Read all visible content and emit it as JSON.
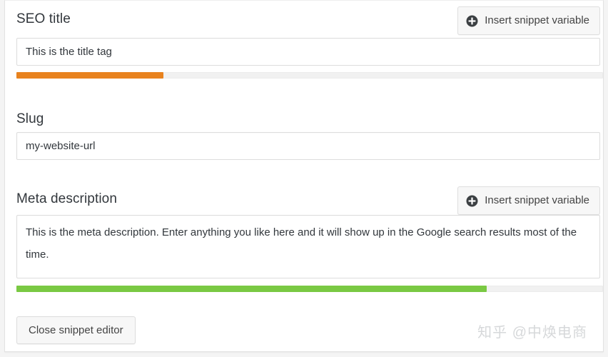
{
  "colors": {
    "orange_bar": "#e8821e",
    "green_bar": "#7ac943",
    "track": "#f1f1f1",
    "card_bg": "#ffffff",
    "page_bg": "#f4f4f4",
    "text": "#32373c",
    "button_bg": "#f7f7f7",
    "button_border": "#dcdcdc",
    "watermark": "#d6d8da"
  },
  "seo_title": {
    "label": "SEO title",
    "insert_button_label": "Insert snippet variable",
    "insert_button_icon": "plus-circle-icon",
    "value": "This is the title tag",
    "placeholder": "",
    "progress": {
      "percent": 25,
      "color": "#e8821e",
      "status": "ok"
    }
  },
  "slug": {
    "label": "Slug",
    "value": "my-website-url",
    "placeholder": ""
  },
  "meta_description": {
    "label": "Meta description",
    "insert_button_label": "Insert snippet variable",
    "insert_button_icon": "plus-circle-icon",
    "value": "This is the meta description. Enter anything you like here and it will show up in the Google search results most of the time.",
    "placeholder": "",
    "progress": {
      "percent": 80,
      "color": "#7ac943",
      "status": "good"
    }
  },
  "footer": {
    "close_button_label": "Close snippet editor",
    "watermark": "知乎 @中焕电商"
  }
}
